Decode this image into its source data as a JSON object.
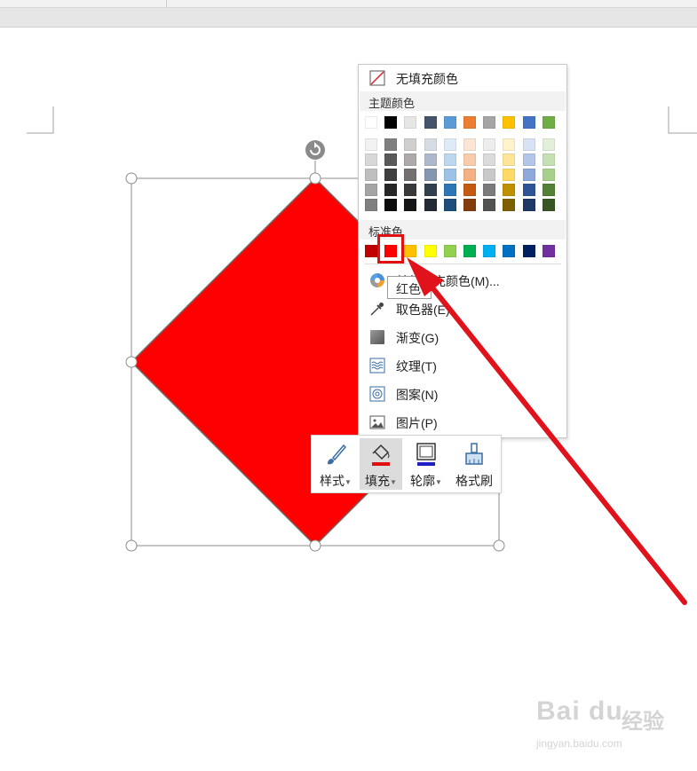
{
  "colors": {
    "selection_fill": "#ff0000",
    "menu_border": "#c8c8c8",
    "highlight_box": "#e01010",
    "arrow": "#e0121c",
    "fill_indicator": "#e01010",
    "outline_indicator": "#1f1fbf"
  },
  "fill_menu": {
    "no_fill": "无填充颜色",
    "theme_colors_title": "主题颜色",
    "theme_top_row": [
      "#ffffff",
      "#000000",
      "#e7e6e6",
      "#44546a",
      "#5b9bd5",
      "#ed7d31",
      "#a5a5a5",
      "#ffc000",
      "#4472c4",
      "#70ad47"
    ],
    "theme_shades": [
      [
        "#f2f2f2",
        "#7f7f7f",
        "#d0cece",
        "#d6dce4",
        "#deebf6",
        "#fbe5d5",
        "#ededed",
        "#fff2cc",
        "#d9e2f3",
        "#e2efd9"
      ],
      [
        "#d8d8d8",
        "#595959",
        "#aeaaaa",
        "#adb9ca",
        "#bdd7ee",
        "#f7cbac",
        "#dbdbdb",
        "#fee599",
        "#b4c6e7",
        "#c5e0b3"
      ],
      [
        "#bfbfbf",
        "#3f3f3f",
        "#757070",
        "#8496b0",
        "#9cc3e5",
        "#f4b183",
        "#c9c9c9",
        "#ffd965",
        "#8eaadb",
        "#a8d08d"
      ],
      [
        "#a5a5a5",
        "#262626",
        "#3a3838",
        "#323f4f",
        "#2e75b5",
        "#c55a11",
        "#7b7b7b",
        "#bf9000",
        "#2f5496",
        "#538135"
      ],
      [
        "#7f7f7f",
        "#0c0c0c",
        "#171616",
        "#222a35",
        "#1e4e79",
        "#833c0b",
        "#525252",
        "#7f6000",
        "#1f3864",
        "#375623"
      ]
    ],
    "standard_title": "标准色",
    "standard_colors": [
      "#c00000",
      "#ff0000",
      "#ffc000",
      "#ffff00",
      "#92d050",
      "#00b050",
      "#00b0f0",
      "#0070c0",
      "#002060",
      "#7030a0"
    ],
    "more_colors": "其他填充颜色(M)...",
    "eyedropper": "取色器(E)",
    "gradient": "渐变(G)",
    "texture": "纹理(T)",
    "pattern": "图案(N)",
    "picture": "图片(P)"
  },
  "tooltip": "红色",
  "toolbar": {
    "style": "样式",
    "fill": "填充",
    "outline": "轮廓",
    "format_painter": "格式刷"
  },
  "watermark": {
    "logo": "Bai du",
    "cn": "经验",
    "url": "jingyan.baidu.com"
  }
}
